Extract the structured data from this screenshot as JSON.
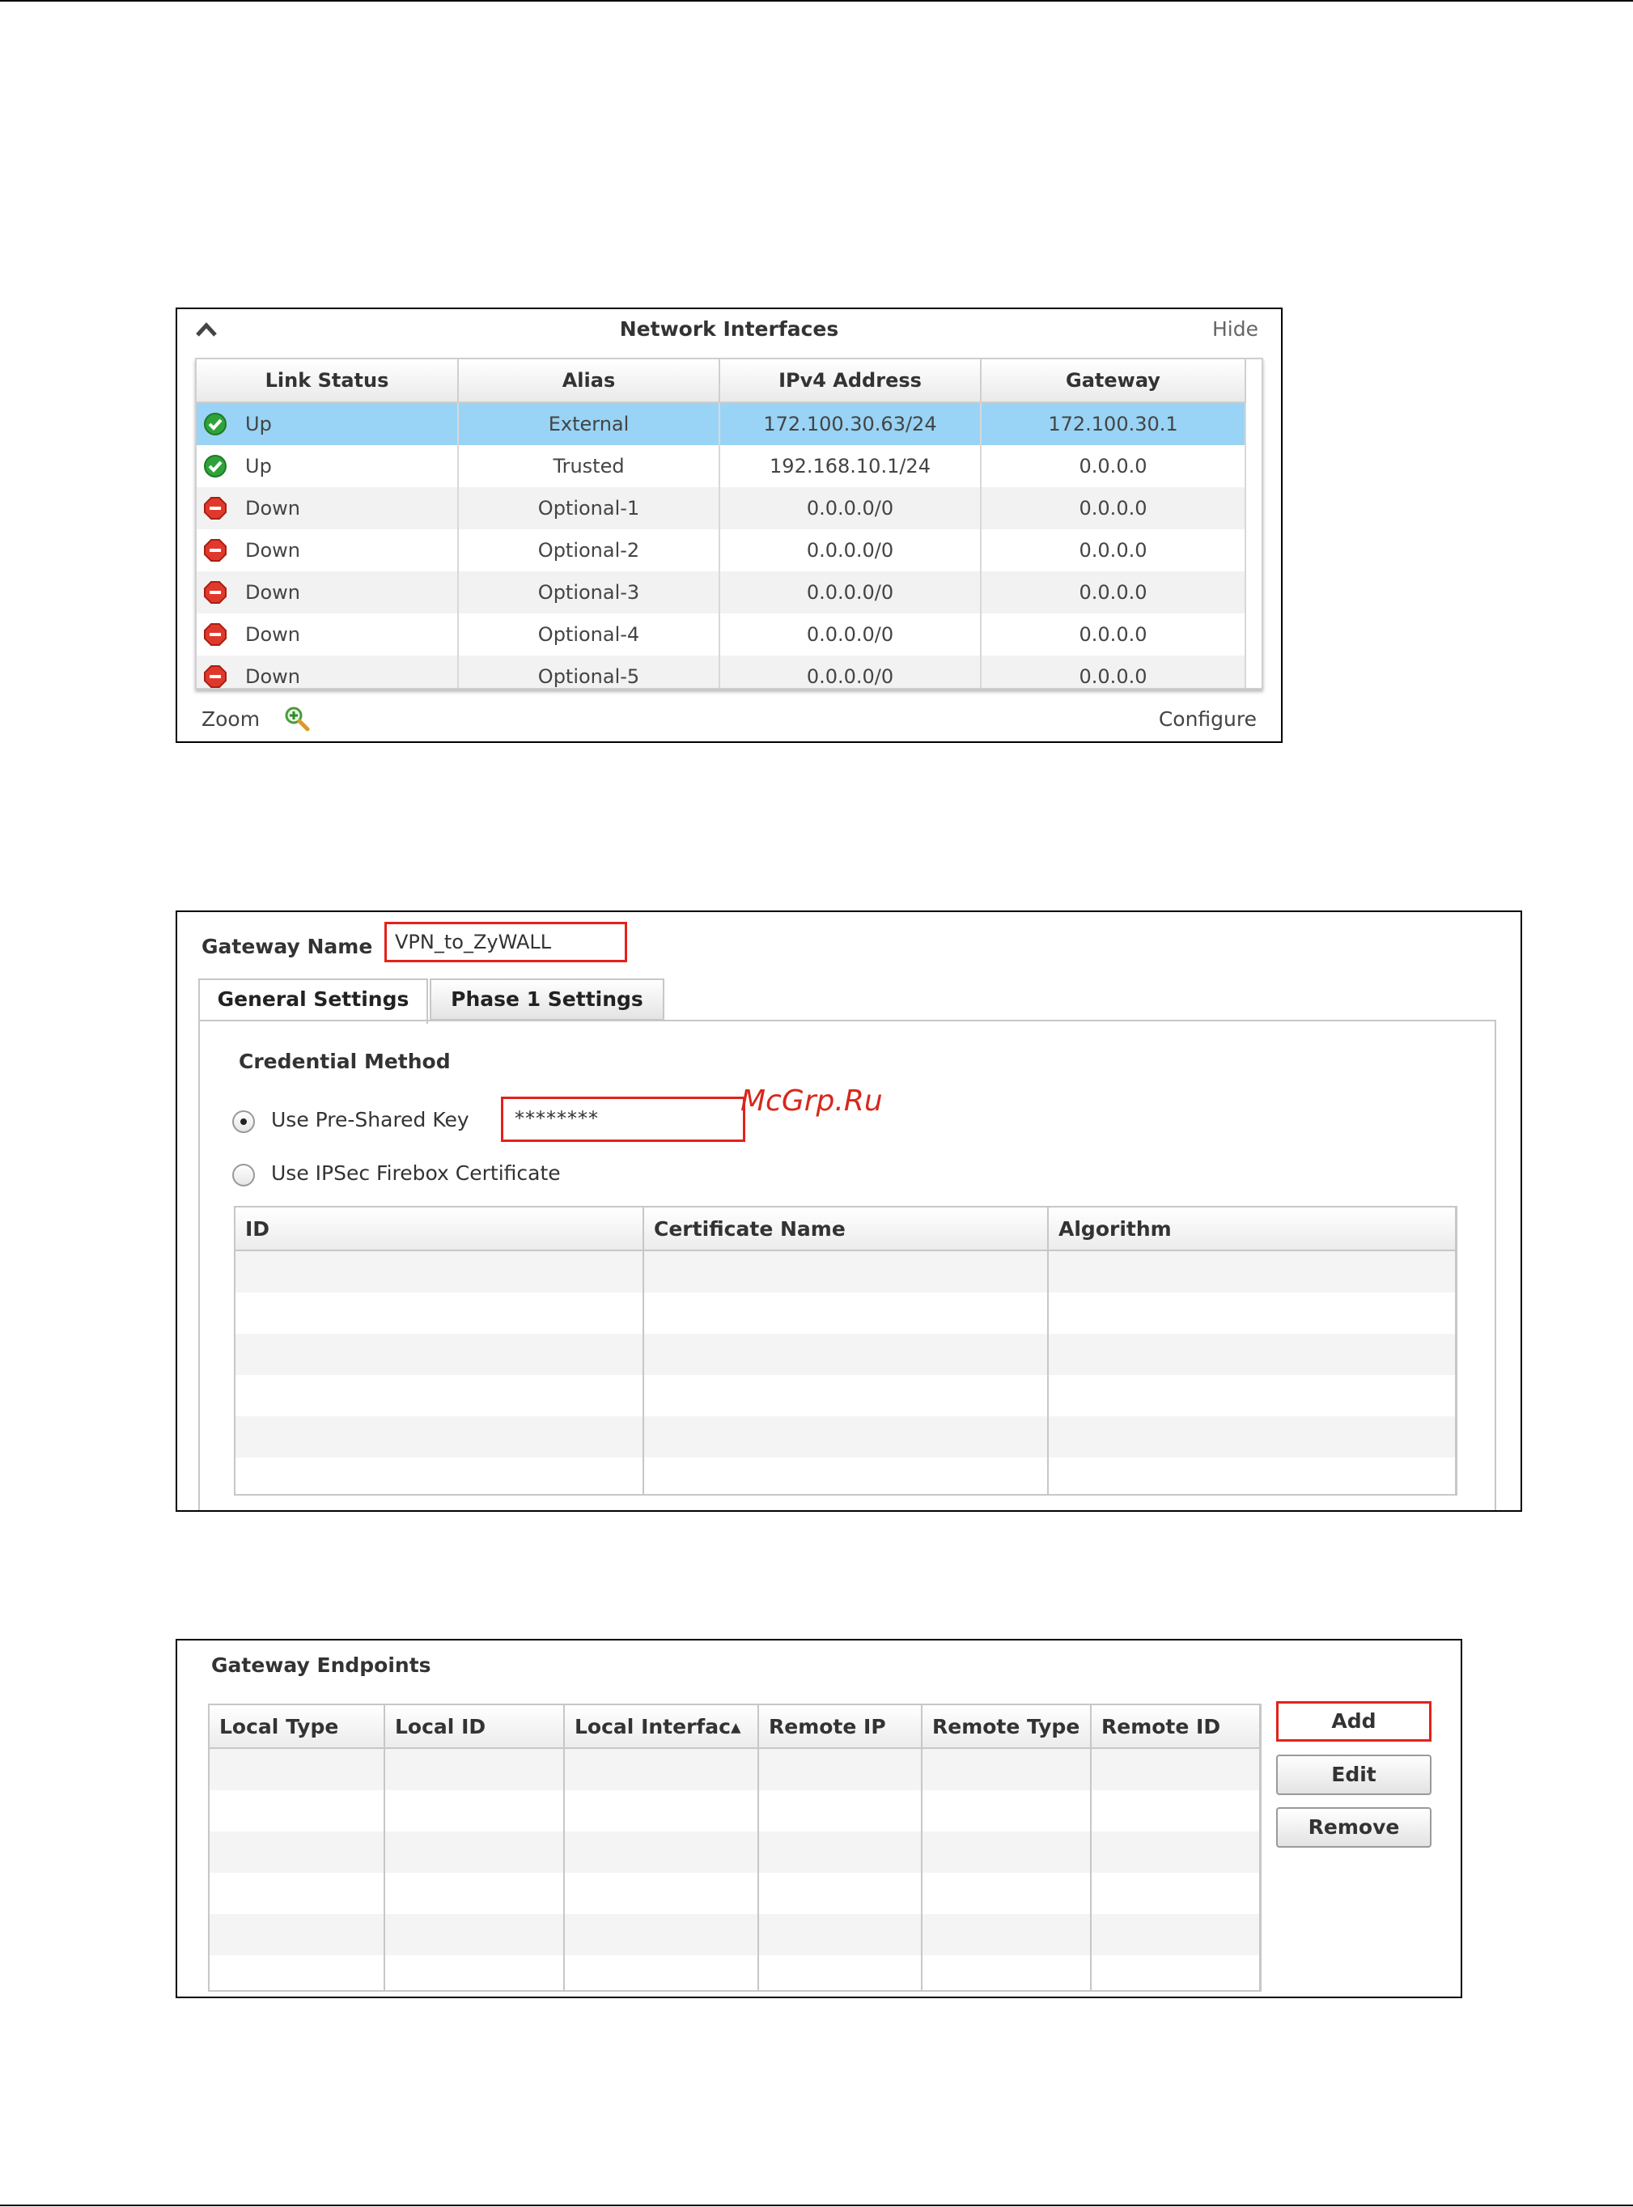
{
  "network_interfaces": {
    "title": "Network Interfaces",
    "hide_label": "Hide",
    "columns": [
      "Link Status",
      "Alias",
      "IPv4 Address",
      "Gateway"
    ],
    "rows": [
      {
        "status": "Up",
        "status_icon": "check-circle-icon",
        "alias": "External",
        "ipv4": "172.100.30.63/24",
        "gateway": "172.100.30.1",
        "selected": true
      },
      {
        "status": "Up",
        "status_icon": "check-circle-icon",
        "alias": "Trusted",
        "ipv4": "192.168.10.1/24",
        "gateway": "0.0.0.0",
        "selected": false
      },
      {
        "status": "Down",
        "status_icon": "stop-sign-icon",
        "alias": "Optional-1",
        "ipv4": "0.0.0.0/0",
        "gateway": "0.0.0.0",
        "selected": false
      },
      {
        "status": "Down",
        "status_icon": "stop-sign-icon",
        "alias": "Optional-2",
        "ipv4": "0.0.0.0/0",
        "gateway": "0.0.0.0",
        "selected": false
      },
      {
        "status": "Down",
        "status_icon": "stop-sign-icon",
        "alias": "Optional-3",
        "ipv4": "0.0.0.0/0",
        "gateway": "0.0.0.0",
        "selected": false
      },
      {
        "status": "Down",
        "status_icon": "stop-sign-icon",
        "alias": "Optional-4",
        "ipv4": "0.0.0.0/0",
        "gateway": "0.0.0.0",
        "selected": false
      },
      {
        "status": "Down",
        "status_icon": "stop-sign-icon",
        "alias": "Optional-5",
        "ipv4": "0.0.0.0/0",
        "gateway": "0.0.0.0",
        "selected": false
      }
    ],
    "zoom_label": "Zoom",
    "configure_label": "Configure",
    "colors": {
      "selected_row": "#99d3f5",
      "up_icon": "#2fa33a",
      "down_icon": "#e0392b"
    }
  },
  "gateway": {
    "name_label": "Gateway Name",
    "name_value": "VPN_to_ZyWALL",
    "tabs": [
      "General Settings",
      "Phase 1 Settings"
    ],
    "active_tab": "General Settings",
    "credential_method_label": "Credential Method",
    "psk_option_label": "Use Pre-Shared Key",
    "psk_value": "********",
    "cert_option_label": "Use IPSec Firebox Certificate",
    "selected_option": "psk",
    "cert_columns": [
      "ID",
      "Certificate Name",
      "Algorithm"
    ],
    "highlight_color": "#e32219"
  },
  "watermark": "McGrp.Ru",
  "endpoints": {
    "title": "Gateway Endpoints",
    "columns": [
      "Local Type",
      "Local ID",
      "Local Interfac▴",
      "Remote IP",
      "Remote Type",
      "Remote ID"
    ],
    "buttons": {
      "add": "Add",
      "edit": "Edit",
      "remove": "Remove"
    }
  }
}
